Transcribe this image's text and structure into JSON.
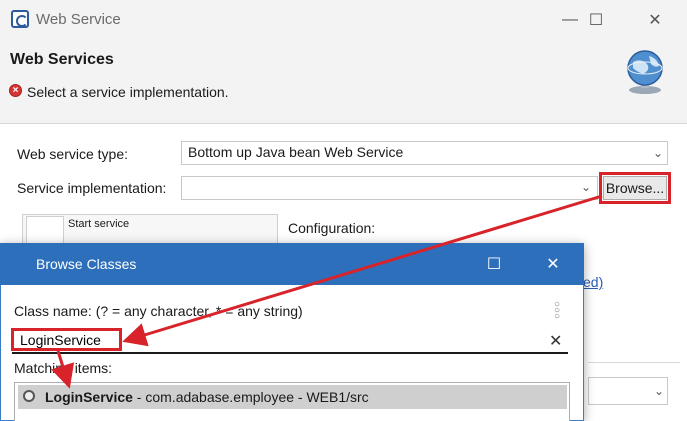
{
  "window": {
    "title": "Web Service",
    "minimize": "—",
    "maximize": "☐",
    "close": "✕"
  },
  "header": {
    "title": "Web Services",
    "error_message": "Select a service implementation."
  },
  "form": {
    "service_type_label": "Web service type:",
    "service_type_value": "Bottom up Java bean Web Service",
    "service_impl_label": "Service implementation:",
    "service_impl_value": "",
    "browse_label": "Browse...",
    "slider_label": "Start service",
    "configuration_label": "Configuration:",
    "partial_link": "ed)"
  },
  "dialog": {
    "title": "Browse Classes",
    "maximize": "☐",
    "close": "✕",
    "class_name_label": "Class name: (? = any character, * = any string)",
    "class_name_value": "LoginService",
    "matching_label": "Matching items:",
    "results": [
      {
        "name": "LoginService",
        "detail": " - com.adabase.employee - WEB1/src"
      }
    ]
  },
  "colors": {
    "accent": "#2e6fbb",
    "highlight": "#d8232a",
    "error": "#d43535",
    "link": "#2a5db0"
  }
}
